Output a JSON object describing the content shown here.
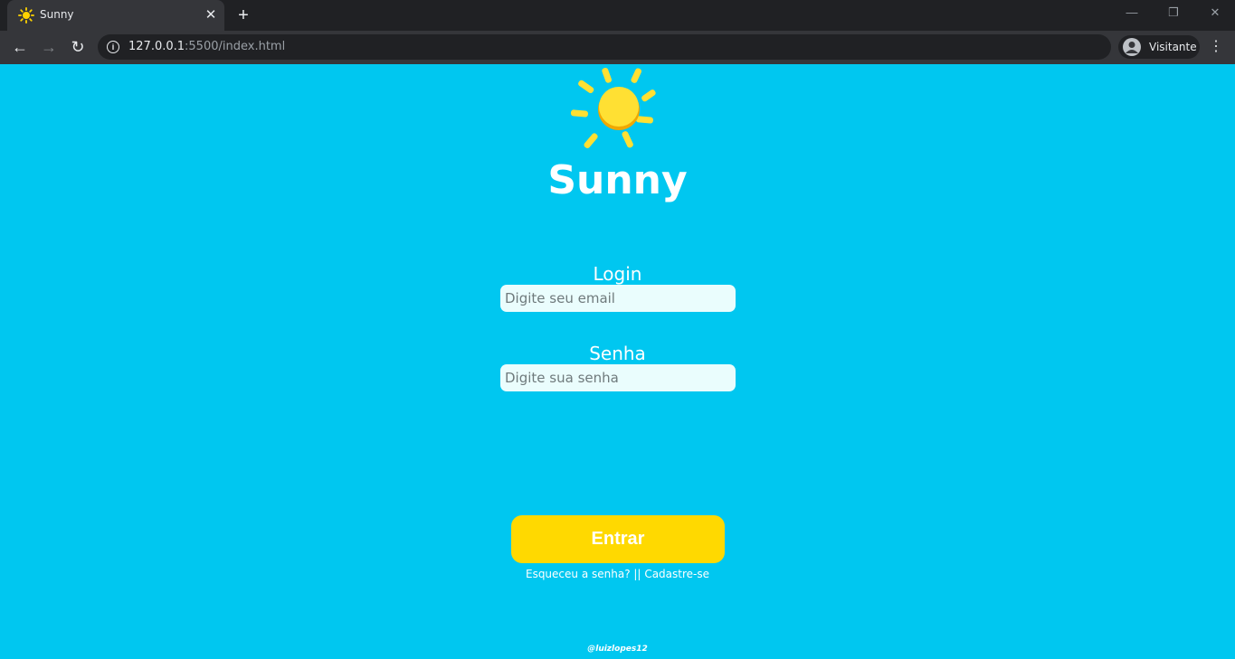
{
  "browser": {
    "tab_title": "Sunny",
    "url_host": "127.0.0.1",
    "url_path": ":5500/index.html",
    "profile_label": "Visitante"
  },
  "page": {
    "app_title": "Sunny",
    "login_label": "Login",
    "email_placeholder": "Digite seu email",
    "email_value": "",
    "password_label": "Senha",
    "password_placeholder": "Digite sua senha",
    "password_value": "",
    "submit_label": "Entrar",
    "forgot_link": "Esqueceu a senha?",
    "separator": "||",
    "signup_link": "Cadastre-se",
    "footer_credit": "@luizlopes12"
  },
  "colors": {
    "background": "#00c7f0",
    "button": "#ffd900",
    "input": "#eafdfd",
    "sun": "#ffe033"
  },
  "icons": [
    "sun-icon",
    "close-icon",
    "plus-icon",
    "minimize-icon",
    "restore-icon",
    "back-arrow-icon",
    "forward-arrow-icon",
    "reload-icon",
    "info-icon",
    "profile-icon",
    "kebab-menu-icon"
  ]
}
